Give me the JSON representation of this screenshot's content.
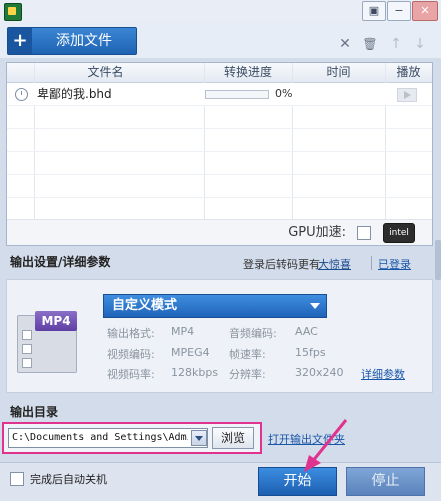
{
  "window": {
    "minimize_glyph": "▣",
    "menu_glyph": "−",
    "close_glyph": "✕"
  },
  "toolbar": {
    "add_file_label": "添加文件",
    "add_file_glyph": "+",
    "tools": [
      {
        "icon": "close-icon",
        "glyph": "✕"
      },
      {
        "icon": "trash-icon",
        "glyph": "🗑"
      },
      {
        "icon": "arrow-up-icon",
        "glyph": "↑"
      },
      {
        "icon": "arrow-down-icon",
        "glyph": "↓"
      }
    ]
  },
  "file_list": {
    "columns": [
      "文件名",
      "转换进度",
      "时间",
      "播放"
    ],
    "rows": [
      {
        "name": "卑鄙的我.bhd",
        "progress_text": "0%",
        "progress": 0,
        "time": ""
      }
    ],
    "gpu_label": "GPU加速:",
    "gpu_checked": false,
    "gpu_brand": "intel"
  },
  "output_settings": {
    "title": "输出设置/详细参数",
    "login_prefix": "登录后转码更有",
    "login_highlight": "大惊喜",
    "login_link": "已登录",
    "format_badge": "MP4",
    "mode": "自定义模式",
    "params": [
      {
        "label": "输出格式:",
        "value": "MP4"
      },
      {
        "label": "音频编码:",
        "value": "AAC"
      },
      {
        "label": "视频编码:",
        "value": "MPEG4"
      },
      {
        "label": "帧速率:",
        "value": "15fps"
      },
      {
        "label": "视频码率:",
        "value": "128kbps"
      },
      {
        "label": "分辨率:",
        "value": "320x240"
      }
    ],
    "detail_link": "详细参数"
  },
  "output_dir": {
    "title": "输出目录",
    "path": "C:\\Documents and Settings\\Admir",
    "browse_label": "浏览",
    "open_folder_label": "打开输出文件夹"
  },
  "footer": {
    "shutdown_label": "完成后自动关机",
    "shutdown_checked": false,
    "start_label": "开始",
    "stop_label": "停止"
  },
  "colors": {
    "accent_blue": "#1f63b8",
    "highlight_magenta": "#e0338f"
  }
}
